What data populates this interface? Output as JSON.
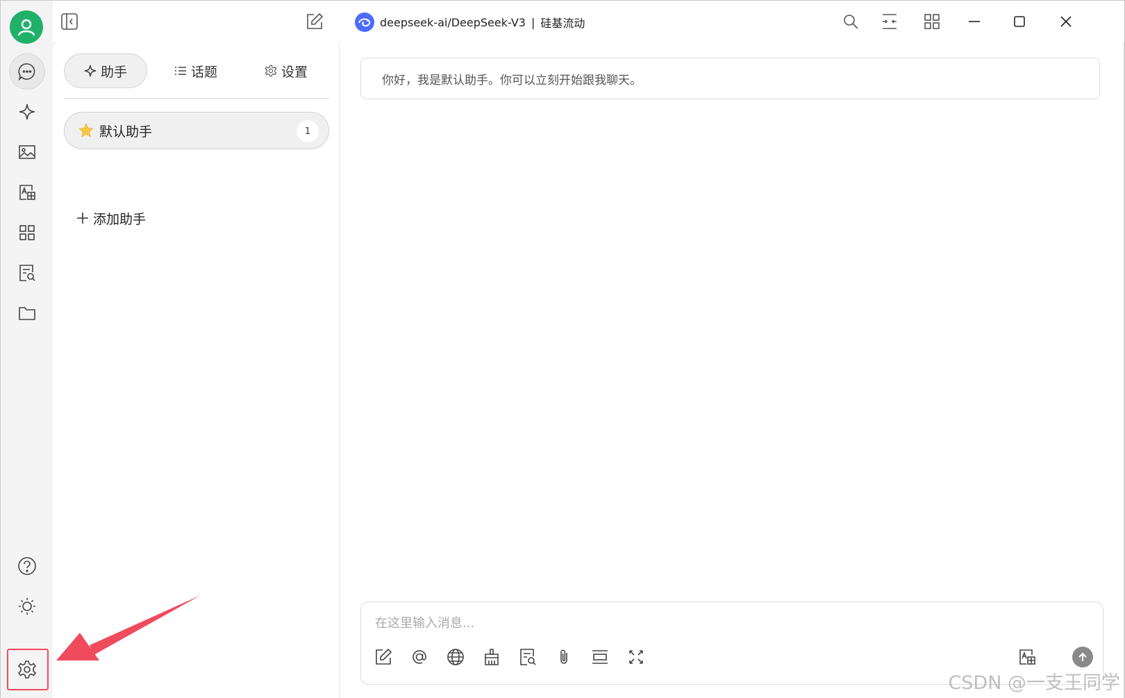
{
  "titlebar": {
    "model_name": "deepseek-ai/DeepSeek-V3",
    "separator": "|",
    "provider": "硅基流动"
  },
  "panel": {
    "tabs": [
      {
        "label": "助手",
        "icon": "sparkle-icon"
      },
      {
        "label": "话题",
        "icon": "list-icon"
      },
      {
        "label": "设置",
        "icon": "gear-icon"
      }
    ],
    "assistant": {
      "name": "默认助手",
      "count": "1",
      "icon": "star-icon"
    },
    "add_label": "添加助手"
  },
  "chat": {
    "greeting": "你好，我是默认助手。你可以立刻开始跟我聊天。",
    "input_placeholder": "在这里输入消息..."
  },
  "watermark": "CSDN @一支王同学",
  "colors": {
    "avatar": "#21b06a",
    "deepseek_logo": "#4d6bfe",
    "highlight": "#f04a5d",
    "star": "#f7c948"
  }
}
